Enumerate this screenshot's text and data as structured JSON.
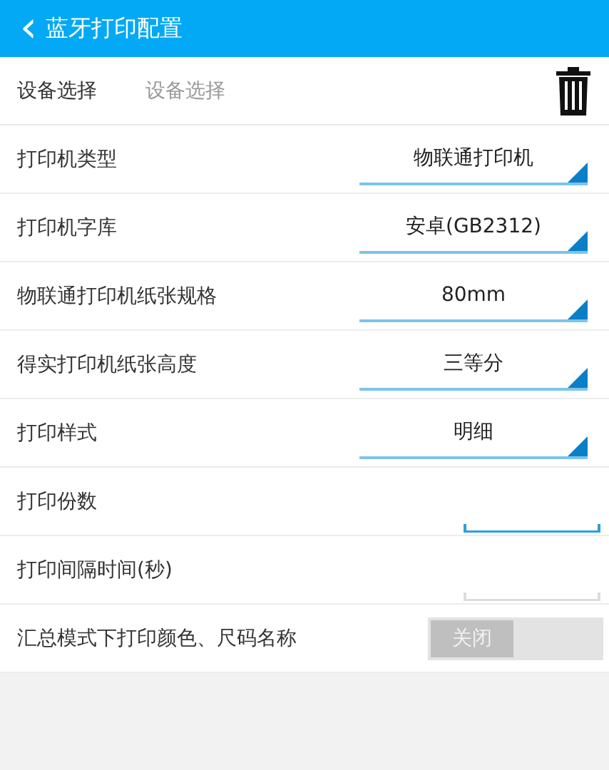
{
  "header": {
    "back_icon": "‹",
    "title": "蓝牙打印配置"
  },
  "device": {
    "label": "设备选择",
    "value": "设备选择"
  },
  "settings": [
    {
      "kind": "spinner",
      "label": "打印机类型",
      "value": "物联通打印机"
    },
    {
      "kind": "spinner",
      "label": "打印机字库",
      "value": "安卓(GB2312)"
    },
    {
      "kind": "spinner",
      "label": "物联通打印机纸张规格",
      "value": "80mm"
    },
    {
      "kind": "spinner",
      "label": "得实打印机纸张高度",
      "value": "三等分"
    },
    {
      "kind": "spinner",
      "label": "打印样式",
      "value": "明细"
    },
    {
      "kind": "input",
      "label": "打印份数",
      "focused": true
    },
    {
      "kind": "input",
      "label": "打印间隔时间(秒)",
      "focused": false
    },
    {
      "kind": "switch",
      "label": "汇总模式下打印颜色、尺码名称",
      "on": false,
      "state_text": "关闭"
    }
  ]
}
